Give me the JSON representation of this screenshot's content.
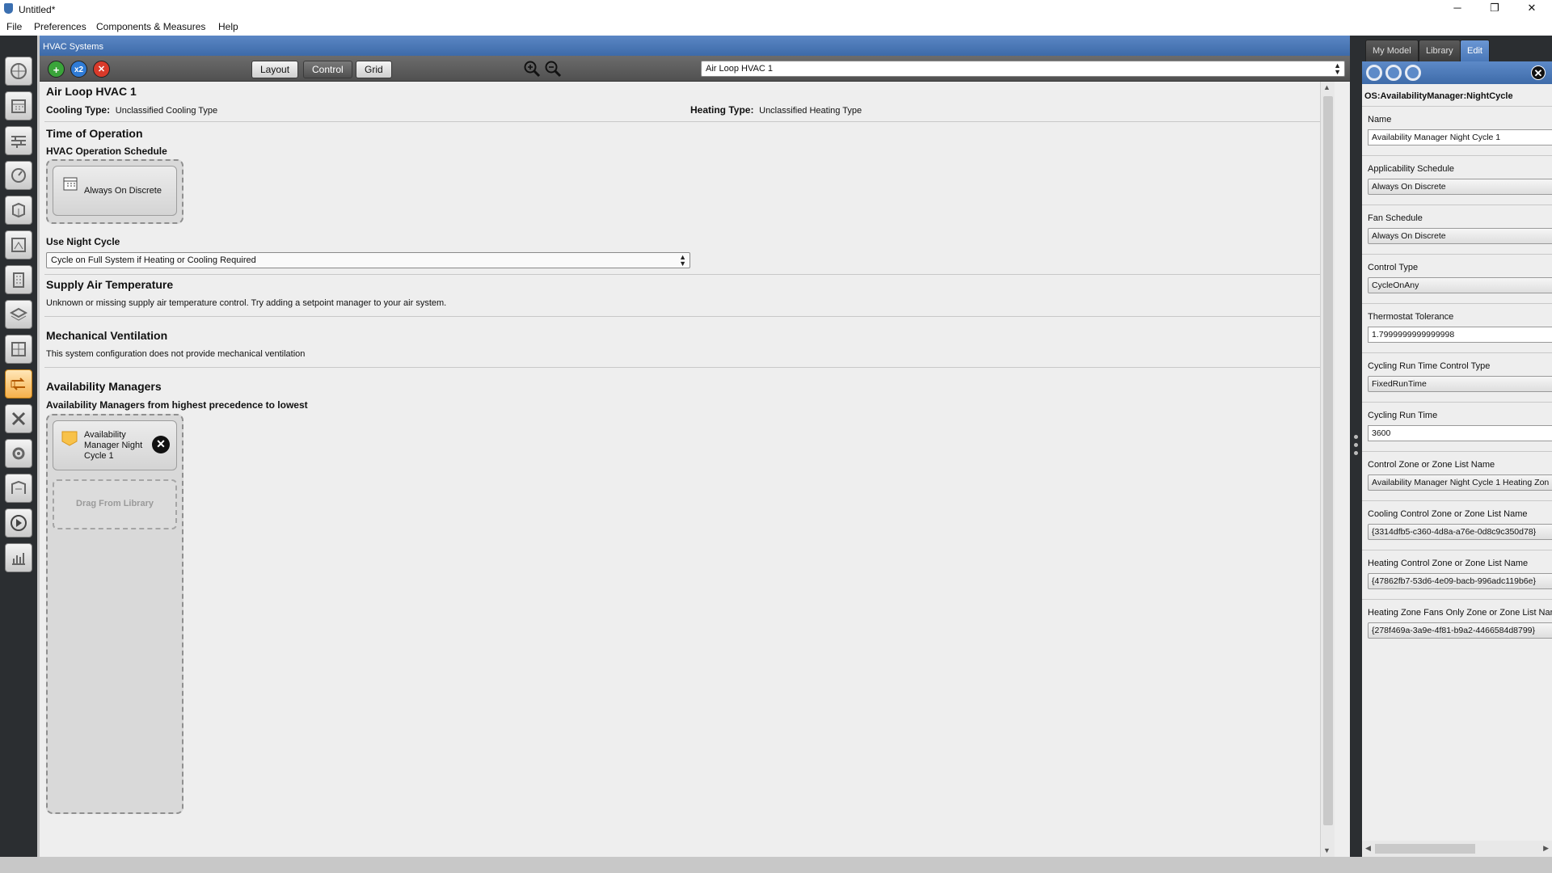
{
  "window": {
    "title": "Untitled*",
    "minimize_glyph": "─",
    "maximize_glyph": "❐",
    "close_glyph": "✕"
  },
  "menu": [
    "File",
    "Preferences",
    "Components & Measures",
    "Help"
  ],
  "left_toolbar": {
    "icons": [
      "site-icon",
      "schedules-icon",
      "constructions-icon",
      "loads-icon",
      "space-types-icon",
      "geometry-icon",
      "facility-icon",
      "spaces-icon",
      "thermal-zones-icon",
      "hvac-systems-icon",
      "building-summary-icon",
      "measures-icon",
      "simulation-settings-icon",
      "run-simulation-icon",
      "results-icon"
    ],
    "active_index": 9
  },
  "main": {
    "header_title": "HVAC Systems",
    "toolbar": {
      "add_glyph": "+",
      "copy_glyph": "x2",
      "delete_glyph": "✕",
      "views": [
        "Layout",
        "Control",
        "Grid"
      ],
      "active_view": "Control",
      "system_selector": "Air Loop HVAC 1"
    },
    "loop_title": "Air Loop HVAC 1",
    "cooling_type_label": "Cooling Type:",
    "cooling_type_value": "Unclassified Cooling Type",
    "heating_type_label": "Heating Type:",
    "heating_type_value": "Unclassified Heating Type",
    "time_of_operation": {
      "heading": "Time of Operation",
      "schedule_label": "HVAC Operation Schedule",
      "schedule_value": "Always On Discrete"
    },
    "night_cycle": {
      "label": "Use Night Cycle",
      "value": "Cycle on Full System if Heating or Cooling Required"
    },
    "supply_air": {
      "heading": "Supply Air Temperature",
      "text": "Unknown or missing supply air temperature control.  Try adding a setpoint manager to your air system."
    },
    "mech_vent": {
      "heading": "Mechanical Ventilation",
      "text": "This system configuration does not provide mechanical ventilation"
    },
    "availability": {
      "heading": "Availability Managers",
      "subheading": "Availability Managers from highest precedence to lowest",
      "manager_line1": "Availability",
      "manager_line2": "Manager Night",
      "manager_line3": "Cycle 1",
      "remove_glyph": "✕",
      "drop_text": "Drag From Library"
    }
  },
  "right_panel": {
    "tabs": [
      "My Model",
      "Library",
      "Edit"
    ],
    "active_tab": "Edit",
    "close_glyph": "✕",
    "object_type": "OS:AvailabilityManager:NightCycle",
    "fields": [
      {
        "label": "Name",
        "value": "Availability Manager Night Cycle 1",
        "kind": "edit"
      },
      {
        "label": "Applicability Schedule",
        "value": "Always On Discrete",
        "kind": "combo"
      },
      {
        "label": "Fan Schedule",
        "value": "Always On Discrete",
        "kind": "combo"
      },
      {
        "label": "Control Type",
        "value": "CycleOnAny",
        "kind": "combo"
      },
      {
        "label": "Thermostat Tolerance",
        "value": "1.7999999999999998",
        "kind": "edit"
      },
      {
        "label": "Cycling Run Time Control Type",
        "value": "FixedRunTime",
        "kind": "combo"
      },
      {
        "label": "Cycling Run Time",
        "value": "3600",
        "kind": "edit"
      },
      {
        "label": "Control Zone or Zone List Name",
        "value": "Availability Manager Night Cycle 1 Heating Zon",
        "kind": "combo"
      },
      {
        "label": "Cooling Control Zone or Zone List Name",
        "value": "{3314dfb5-c360-4d8a-a76e-0d8c9c350d78}",
        "kind": "combo"
      },
      {
        "label": "Heating Control Zone or Zone List Name",
        "value": "{47862fb7-53d6-4e09-bacb-996adc119b6e}",
        "kind": "combo"
      },
      {
        "label": "Heating Zone Fans Only Zone or Zone List Name",
        "value": "{278f469a-3a9e-4f81-b9a2-4466584d8799}",
        "kind": "combo"
      }
    ]
  },
  "colors": {
    "header_blue": "#4a78b8",
    "dark_chrome": "#2b2e31",
    "add_green": "#3aa43a",
    "copy_blue": "#2f7bd6",
    "delete_red": "#d93a2a",
    "active_tab_orange": "#f6b04a"
  }
}
